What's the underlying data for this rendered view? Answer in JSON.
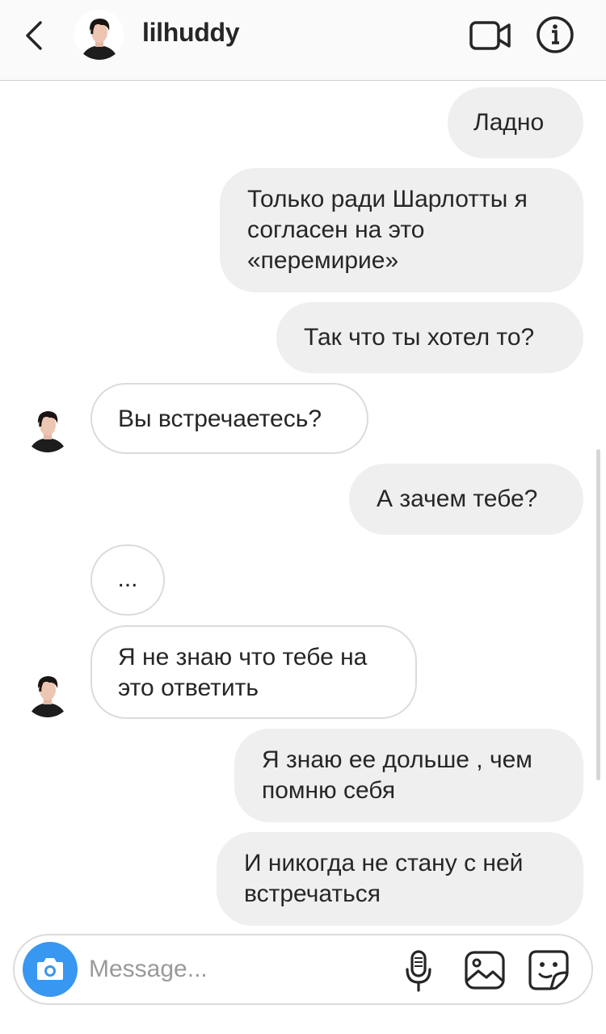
{
  "header": {
    "username": "lilhuddy",
    "back_icon": "chevron-left-icon",
    "video_icon": "video-camera-icon",
    "info_icon": "info-icon"
  },
  "messages": [
    {
      "from": "me",
      "text": "Ладно"
    },
    {
      "from": "me",
      "text": "Только ради Шарлотты я согласен на это «перемирие»"
    },
    {
      "from": "me",
      "text": "Так что ты хотел то?"
    },
    {
      "from": "them",
      "text": "Вы встречаетесь?"
    },
    {
      "from": "me",
      "text": "А зачем тебе?"
    },
    {
      "from": "them",
      "text": "..."
    },
    {
      "from": "them",
      "text": "Я не знаю что тебе на это ответить"
    },
    {
      "from": "me",
      "text": "Я знаю ее дольше , чем помню себя"
    },
    {
      "from": "me",
      "text": "И никогда не стану с ней встречаться"
    }
  ],
  "composer": {
    "placeholder": "Message...",
    "camera_icon": "camera-icon",
    "mic_icon": "microphone-icon",
    "gallery_icon": "gallery-icon",
    "sticker_icon": "sticker-icon"
  },
  "colors": {
    "sent_bubble": "#efefef",
    "received_border": "#dbdbdb",
    "camera_button": "#3897f0",
    "header_bg": "#fafafa"
  }
}
